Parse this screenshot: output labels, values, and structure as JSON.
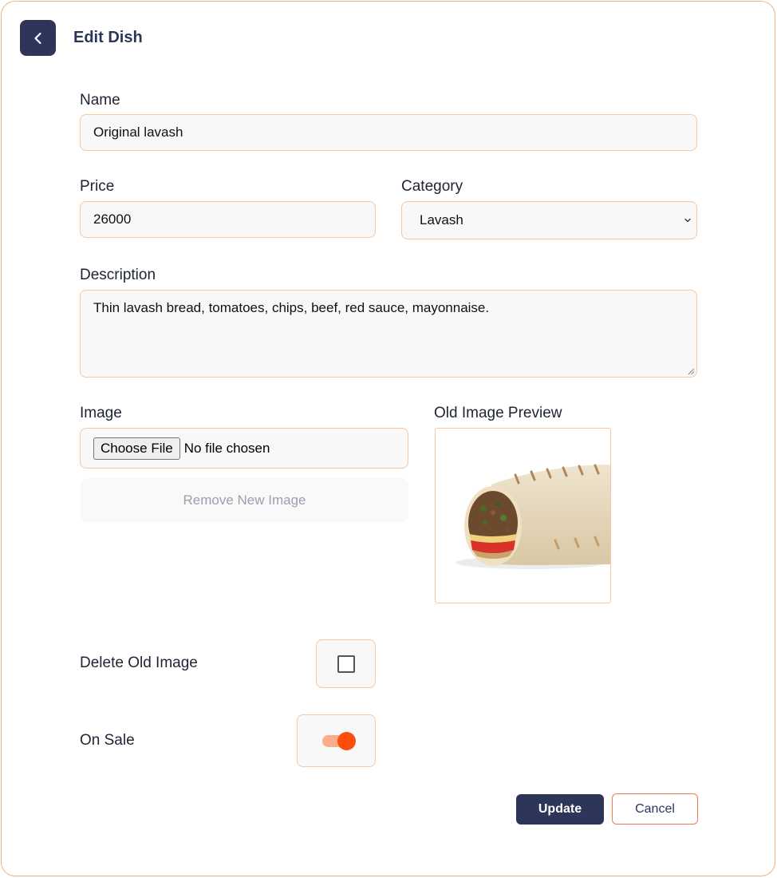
{
  "header": {
    "title": "Edit Dish",
    "back_icon": "chevron-left-icon"
  },
  "form": {
    "name": {
      "label": "Name",
      "value": "Original lavash"
    },
    "price": {
      "label": "Price",
      "value": "26000"
    },
    "category": {
      "label": "Category",
      "selected": "Lavash"
    },
    "description": {
      "label": "Description",
      "value": "Thin lavash bread, tomatoes, chips, beef, red sauce, mayonnaise."
    },
    "image": {
      "label": "Image",
      "choose_button": "Choose File",
      "status": "No file chosen",
      "remove_button": "Remove New Image"
    },
    "old_image": {
      "label": "Old Image Preview"
    },
    "delete_old_image": {
      "label": "Delete Old Image",
      "checked": false
    },
    "on_sale": {
      "label": "On Sale",
      "enabled": true
    }
  },
  "actions": {
    "update_label": "Update",
    "cancel_label": "Cancel"
  },
  "colors": {
    "primary": "#2d3659",
    "accent": "#fd4d0c",
    "border": "#f9c69e"
  }
}
